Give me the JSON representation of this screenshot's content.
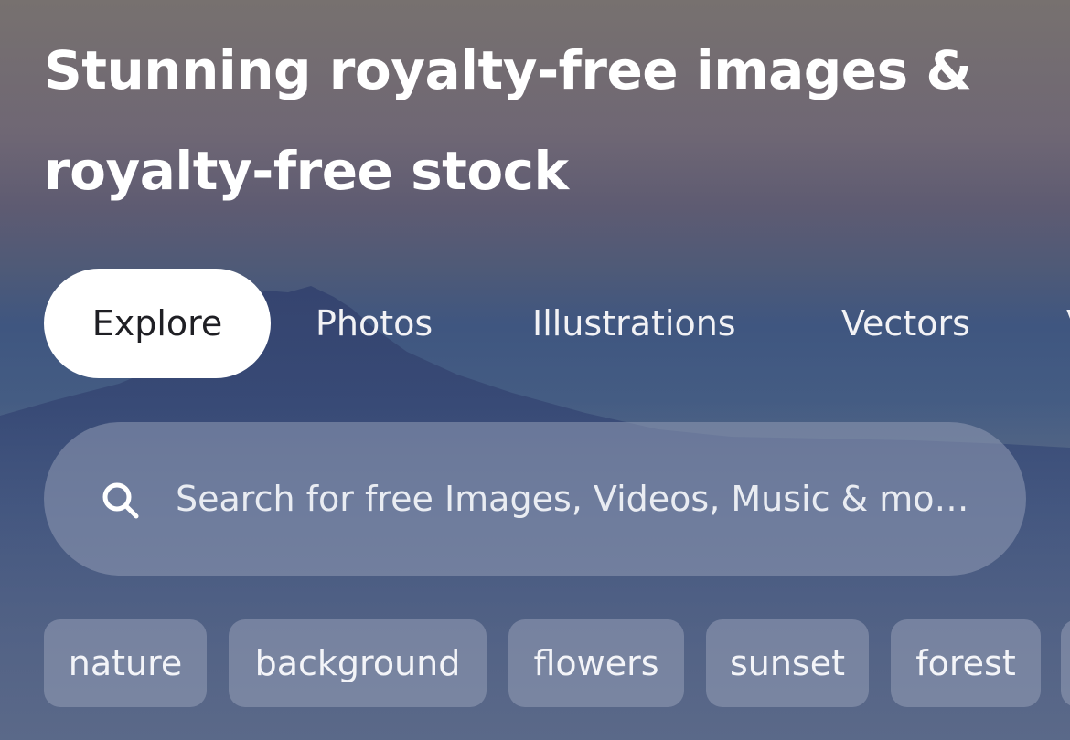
{
  "hero": {
    "title": "Stunning royalty-free images & royalty-free stock"
  },
  "tabs": [
    {
      "label": "Explore",
      "active": true
    },
    {
      "label": "Photos",
      "active": false
    },
    {
      "label": "Illustrations",
      "active": false
    },
    {
      "label": "Vectors",
      "active": false
    },
    {
      "label": "V",
      "active": false
    }
  ],
  "search": {
    "icon": "search-icon",
    "placeholder": "Search for free Images, Videos, Music & mo…"
  },
  "chips": [
    {
      "label": "nature"
    },
    {
      "label": "background"
    },
    {
      "label": "flowers"
    },
    {
      "label": "sunset"
    },
    {
      "label": "forest"
    },
    {
      "label": ""
    }
  ],
  "colors": {
    "active_tab_bg": "#ffffff",
    "active_tab_text": "#1f1f24",
    "text_light": "#ffffff"
  }
}
